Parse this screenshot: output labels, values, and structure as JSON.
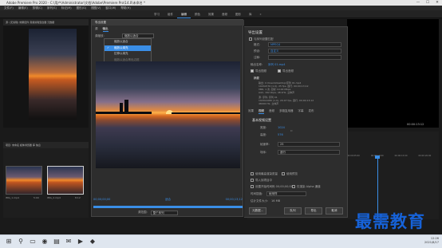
{
  "window": {
    "title": "Adobe Premiere Pro 2020 - C:\\用户\\Administrator\\文档\\Adobe\\Premiere Pro\\14.0\\未命名 *",
    "controls": [
      "—",
      "☐",
      "✕"
    ]
  },
  "menubar": {
    "items": [
      "文件(F)",
      "编辑(E)",
      "剪辑(C)",
      "序列(S)",
      "标记(M)",
      "图形(G)",
      "视图(V)",
      "窗口(W)",
      "帮助(H)"
    ]
  },
  "workspace_tabs": [
    "学习",
    "组件",
    "编辑",
    "颜色",
    "效果",
    "音频",
    "图形",
    "库",
    "»"
  ],
  "workspace_active_index": 2,
  "source_panel": {
    "tab": "源: (无剪辑)   效果控件   音频剪辑混合器   元数据",
    "timecode": "00:00:00:00"
  },
  "program_panel": {
    "timecode": "00:00:13:12"
  },
  "project_panel": {
    "tab": "项目: 未命名   媒体浏览器   库   信息",
    "clips": [
      {
        "name": "IMG_1.mp4",
        "duration": "5:00"
      },
      {
        "name": "IMG_2.mp4",
        "duration": "8:12"
      }
    ]
  },
  "timeline": {
    "ruler": [
      "00:00:05:00",
      "00:00:10:00",
      "00:00:15:00",
      "00:00:20:00"
    ]
  },
  "export_dialog": {
    "title": "导出设置",
    "source_tabs": [
      "源",
      "输出"
    ],
    "source_tab_active": 1,
    "scale_label": "源缩放:",
    "scale_value": "缩放以适合",
    "scale_menu": [
      {
        "label": "缩放以适合",
        "checked": false,
        "highlight": false,
        "dim": false
      },
      {
        "label": "缩放以填充",
        "checked": true,
        "highlight": true,
        "dim": false
      },
      {
        "label": "拉伸以填充",
        "checked": false,
        "highlight": false,
        "dim": false
      },
      {
        "label": "缩放以适合黑色边框",
        "checked": false,
        "highlight": false,
        "dim": true
      },
      {
        "label": "更改输出尺寸以匹配源",
        "checked": false,
        "highlight": false,
        "dim": true
      }
    ],
    "tc_start": "00;00;00;00",
    "tc_end": "00;00;13;12",
    "tc_mid": "适合",
    "range_label": "源范围:",
    "range_value": "整个序列"
  },
  "export_settings": {
    "section_title": "导出设置",
    "match_label": "与序列设置匹配",
    "format_label": "格式:",
    "format_value": "MPEG4",
    "preset_label": "预设:",
    "preset_value": "自定义",
    "comment_label": "注释:",
    "output_name_label": "输出名称:",
    "output_name_value": "序列 01.mp4",
    "export_video": "导出视频",
    "export_audio": "导出音频",
    "summary_title": "摘要",
    "summary_lines": [
      "输出: C:\\Users\\Desktop\\序列 01.mp4",
      "1024x576 (1.0), 25 fps, 逐行, 00;00;13;12",
      "VBR, 1 次, 目标 10.00 Mbps",
      "AAC, 192 kbps, 48 kHz, 立体声",
      "源: 序列, 序列 01",
      "1920x1080 (1.0), 29.97 fps, 逐行, 00;00;13;12",
      "48000 Hz, 立体声"
    ],
    "tabs": [
      "效果",
      "视频",
      "音频",
      "多路复用器",
      "字幕",
      "发布"
    ],
    "tab_active": 1,
    "basic_title": "基本视频设置",
    "width_label": "宽度:",
    "width_value": "1024",
    "height_label": "高度:",
    "height_value": "576",
    "fps_label": "帧速率:",
    "fps_value": "25",
    "order_label": "场序:",
    "order_value": "逐行",
    "opt_max_depth": "使用最高渲染质量",
    "opt_preview": "使用预览",
    "opt_import": "导入到项目中",
    "opt_start_tc": "设置开始时间码 00;00;00;00",
    "opt_alpha": "仅渲染 Alpha 通道",
    "interp_label": "时间插值:",
    "interp_value": "帧采样",
    "filesize_label": "估计文件大小:",
    "filesize_value": "16 MB",
    "btn_metadata": "元数据...",
    "btn_queue": "队列",
    "btn_export": "导出",
    "btn_cancel": "取消"
  },
  "watermark": "最需教育",
  "taskbar": {
    "icons": [
      "⊞",
      "⚲",
      "▭",
      "◉",
      "▤",
      "✉",
      "▶",
      "◆"
    ],
    "time": "12:26",
    "date": "2021/8/17"
  }
}
